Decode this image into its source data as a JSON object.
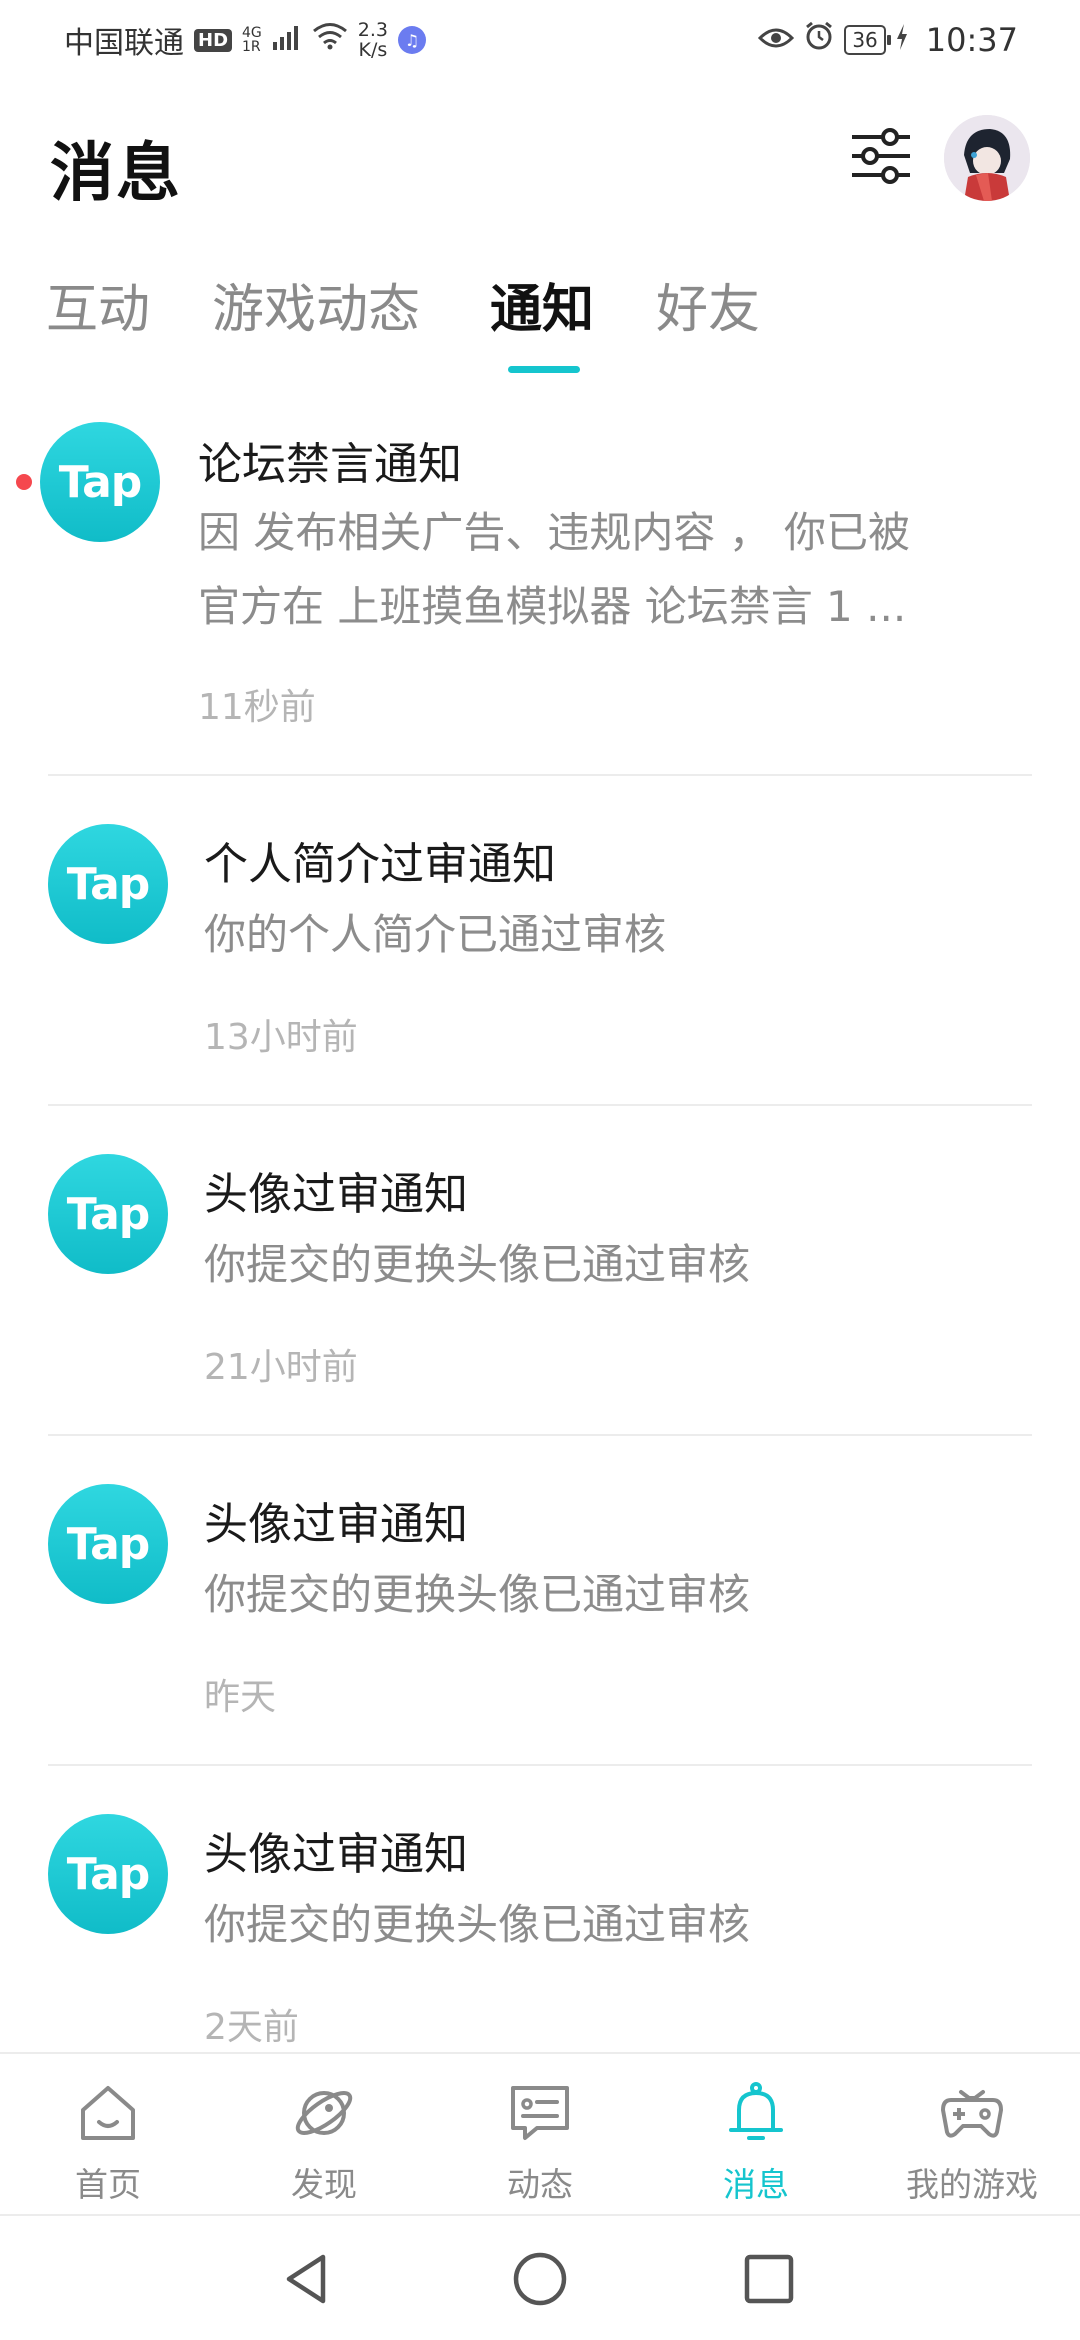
{
  "status_bar": {
    "carrier": "中国联通",
    "hd_badge": "HD",
    "signal_label_top": "4G",
    "signal_label_bottom": "1R",
    "net_speed_value": "2.3",
    "net_speed_unit": "K/s",
    "battery": "36",
    "time": "10:37"
  },
  "header": {
    "title": "消息"
  },
  "tabs": [
    {
      "label": "互动",
      "active": false
    },
    {
      "label": "游戏动态",
      "active": false
    },
    {
      "label": "通知",
      "active": true
    },
    {
      "label": "好友",
      "active": false
    }
  ],
  "notifications": [
    {
      "logo": "Tap",
      "title": "论坛禁言通知",
      "body_line1": "因 发布相关广告、违规内容 ， 你已被",
      "body_line2": "官方在 上班摸鱼模拟器 论坛禁言 1 ...",
      "time": "11秒前",
      "unread": true
    },
    {
      "logo": "Tap",
      "title": "个人简介过审通知",
      "body_line1": "你的个人简介已通过审核",
      "body_line2": "",
      "time": "13小时前",
      "unread": false
    },
    {
      "logo": "Tap",
      "title": "头像过审通知",
      "body_line1": "你提交的更换头像已通过审核",
      "body_line2": "",
      "time": "21小时前",
      "unread": false
    },
    {
      "logo": "Tap",
      "title": "头像过审通知",
      "body_line1": "你提交的更换头像已通过审核",
      "body_line2": "",
      "time": "昨天",
      "unread": false
    },
    {
      "logo": "Tap",
      "title": "头像过审通知",
      "body_line1": "你提交的更换头像已通过审核",
      "body_line2": "",
      "time": "2天前",
      "unread": false
    }
  ],
  "bottom_nav": [
    {
      "label": "首页",
      "icon": "home-icon",
      "active": false
    },
    {
      "label": "发现",
      "icon": "planet-icon",
      "active": false
    },
    {
      "label": "动态",
      "icon": "chat-card-icon",
      "active": false
    },
    {
      "label": "消息",
      "icon": "bell-icon",
      "active": true
    },
    {
      "label": "我的游戏",
      "icon": "gamepad-icon",
      "active": false
    }
  ],
  "colors": {
    "accent": "#15c5ce",
    "unread_dot": "#f5484e",
    "secondary_text": "#8c8c8c"
  }
}
